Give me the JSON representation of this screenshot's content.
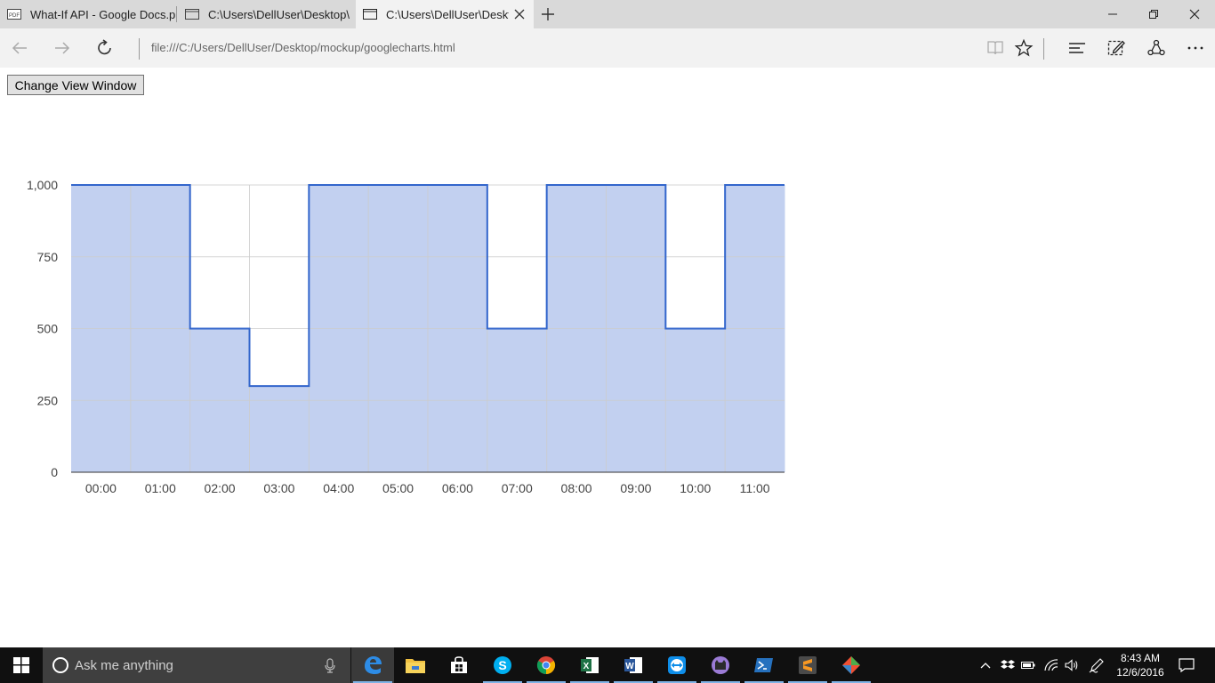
{
  "browser": {
    "tabs": [
      {
        "label": "What-If API - Google Docs.p"
      },
      {
        "label": "C:\\Users\\DellUser\\Desktop\\"
      },
      {
        "label": "C:\\Users\\DellUser\\Deskt"
      }
    ],
    "address": "file:///C:/Users/DellUser/Desktop/mockup/googlecharts.html"
  },
  "page": {
    "button_label": "Change View Window"
  },
  "chart_data": {
    "type": "area",
    "style": "stepped",
    "x": [
      "00:00",
      "01:00",
      "02:00",
      "03:00",
      "04:00",
      "05:00",
      "06:00",
      "07:00",
      "08:00",
      "09:00",
      "10:00",
      "11:00"
    ],
    "values": [
      1000,
      1000,
      500,
      300,
      1000,
      1000,
      1000,
      500,
      1000,
      1000,
      500,
      1000
    ],
    "ylim": [
      0,
      1000
    ],
    "yticks": [
      "0",
      "250",
      "500",
      "750",
      "1,000"
    ],
    "ytick_values": [
      0,
      250,
      500,
      750,
      1000
    ],
    "grid": true,
    "colors": {
      "line": "#3366cc",
      "fill": "#c2d0f0",
      "grid": "#cccccc",
      "axis": "#333333"
    }
  },
  "taskbar": {
    "search_placeholder": "Ask me anything",
    "time": "8:43 AM",
    "date": "12/6/2016",
    "apps": [
      "edge-icon",
      "file-explorer-icon",
      "store-icon",
      "skype-icon",
      "chrome-icon",
      "excel-icon",
      "word-icon",
      "teamviewer-icon",
      "github-icon",
      "powershell-icon",
      "sublime-icon",
      "git-icon"
    ]
  }
}
